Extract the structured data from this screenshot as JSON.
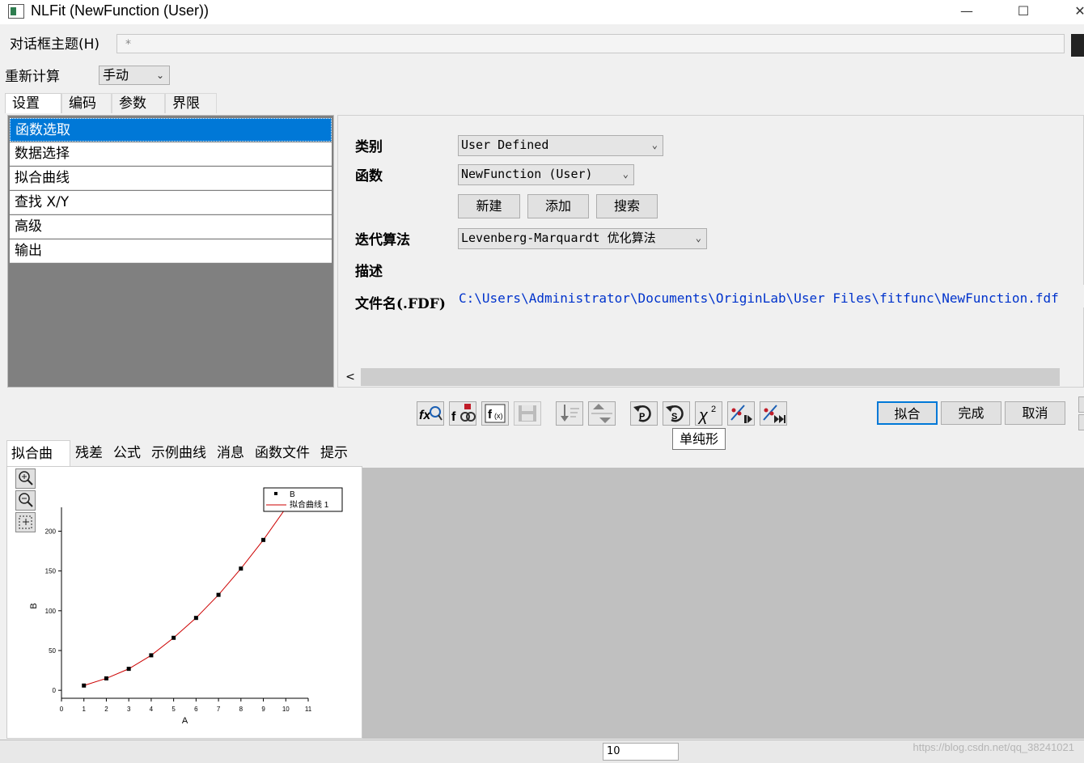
{
  "window": {
    "title": "NLFit (NewFunction (User))",
    "minimize_glyph": "—",
    "maximize_glyph": "☐",
    "close_glyph": "✕"
  },
  "header": {
    "theme_label": "对话框主题(H)",
    "theme_value": "*",
    "recalc_label": "重新计算",
    "recalc_value": "手动"
  },
  "tabs": [
    {
      "label": "设置",
      "active": true
    },
    {
      "label": "编码"
    },
    {
      "label": "参数"
    },
    {
      "label": "界限"
    }
  ],
  "nav": [
    {
      "label": "函数选取",
      "selected": true
    },
    {
      "label": "数据选择"
    },
    {
      "label": "拟合曲线"
    },
    {
      "label": "查找 X/Y"
    },
    {
      "label": "高级"
    },
    {
      "label": "输出"
    }
  ],
  "settings": {
    "category_label": "类别",
    "category_value": "User Defined",
    "function_label": "函数",
    "function_value": "NewFunction (User)",
    "new_button": "新建",
    "add_button": "添加",
    "search_button": "搜索",
    "iteration_label": "迭代算法",
    "iteration_value": "Levenberg-Marquardt 优化算法",
    "description_label": "描述",
    "filename_label": "文件名(.FDF)",
    "filename_value": "C:\\Users\\Administrator\\Documents\\OriginLab\\User Files\\fitfunc\\NewFunction.fdf"
  },
  "toolbar": {
    "icons": [
      "fx-search-icon",
      "f-gear-icon",
      "f-param-icon",
      "save-icon",
      "sort-down-icon",
      "sort-up-icon",
      "undo-p-icon",
      "undo-s-icon",
      "chi-square-icon",
      "fit-iterate-icon",
      "fit-until-converge-icon"
    ],
    "tooltip": "单纯形"
  },
  "actions": {
    "fit": "拟合",
    "done": "完成",
    "cancel": "取消"
  },
  "bottom_tabs": [
    {
      "label": "拟合曲线",
      "active": true
    },
    {
      "label": "残差"
    },
    {
      "label": "公式"
    },
    {
      "label": "示例曲线"
    },
    {
      "label": "消息"
    },
    {
      "label": "函数文件"
    },
    {
      "label": "提示"
    }
  ],
  "chart_data": {
    "type": "scatter",
    "x": [
      1,
      2,
      3,
      4,
      5,
      6,
      7,
      8,
      9,
      10
    ],
    "series": [
      {
        "name": "B",
        "values": [
          6,
          15,
          27,
          44,
          66,
          91,
          120,
          153,
          189,
          229
        ],
        "marker": "square",
        "color": "#000000"
      },
      {
        "name": "拟合曲线 1",
        "values": [
          6,
          15,
          27,
          44,
          66,
          91,
          120,
          153,
          189,
          229
        ],
        "style": "line",
        "color": "#cc0000"
      }
    ],
    "xlabel": "A",
    "ylabel": "B",
    "xlim": [
      0,
      11
    ],
    "ylim": [
      -10,
      230
    ],
    "xticks": [
      0,
      1,
      2,
      3,
      4,
      5,
      6,
      7,
      8,
      9,
      10,
      11
    ],
    "yticks": [
      0,
      50,
      100,
      150,
      200
    ],
    "legend": "top-right"
  },
  "watermark": "https://blog.csdn.net/qq_38241021",
  "status_value": "10"
}
